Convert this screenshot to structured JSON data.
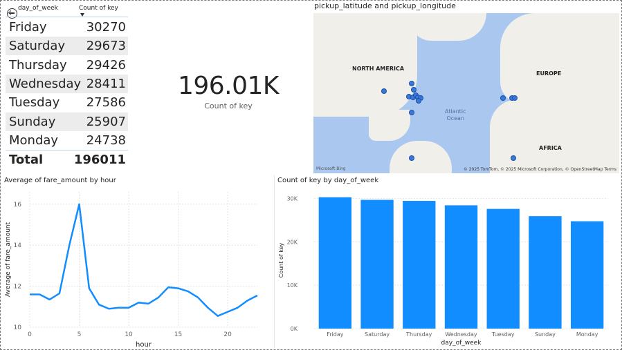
{
  "table": {
    "col1_header": "day_of_week",
    "col2_header": "Count of key",
    "rows": [
      {
        "day": "Friday",
        "count": "30270"
      },
      {
        "day": "Saturday",
        "count": "29673"
      },
      {
        "day": "Thursday",
        "count": "29426"
      },
      {
        "day": "Wednesday",
        "count": "28411"
      },
      {
        "day": "Tuesday",
        "count": "27586"
      },
      {
        "day": "Sunday",
        "count": "25907"
      },
      {
        "day": "Monday",
        "count": "24738"
      }
    ],
    "total_label": "Total",
    "total_value": "196011"
  },
  "card": {
    "value": "196.01K",
    "label": "Count of key"
  },
  "map": {
    "title": "pickup_latitude and pickup_longitude",
    "labels": {
      "north_america": "NORTH AMERICA",
      "europe": "EUROPE",
      "africa": "AFRICA",
      "ocean_line1": "Atlantic",
      "ocean_line2": "Ocean"
    },
    "attribution": "© 2025 TomTom, © 2025 Microsoft Corporation, © OpenStreetMap  Terms",
    "provider": "Microsoft Bing",
    "pin_color": "#3a78d8"
  },
  "chart_data": [
    {
      "type": "line",
      "title": "Average of fare_amount by hour",
      "xlabel": "hour",
      "ylabel": "Average of fare_amount",
      "x": [
        0,
        1,
        2,
        3,
        4,
        5,
        6,
        7,
        8,
        9,
        10,
        11,
        12,
        13,
        14,
        15,
        16,
        17,
        18,
        19,
        20,
        21,
        22,
        23
      ],
      "values": [
        11.6,
        11.6,
        11.35,
        11.65,
        14.0,
        16.0,
        11.9,
        11.1,
        10.9,
        10.95,
        10.95,
        11.2,
        11.15,
        11.45,
        11.95,
        11.9,
        11.75,
        11.45,
        10.95,
        10.55,
        10.75,
        10.95,
        11.3,
        11.55
      ],
      "xlim": [
        0,
        23
      ],
      "ylim": [
        10,
        16.6
      ],
      "xticks": [
        0,
        5,
        10,
        15,
        20
      ],
      "yticks": [
        10,
        12,
        14,
        16
      ],
      "color": "#118dff",
      "grid": true
    },
    {
      "type": "bar",
      "title": "Count of key by day_of_week",
      "xlabel": "day_of_week",
      "ylabel": "Count of key",
      "categories": [
        "Friday",
        "Saturday",
        "Thursday",
        "Wednesday",
        "Tuesday",
        "Sunday",
        "Monday"
      ],
      "values": [
        30270,
        29673,
        29426,
        28411,
        27586,
        25907,
        24738
      ],
      "ylim": [
        0,
        31500
      ],
      "yticks": [
        0,
        10000,
        20000,
        30000
      ],
      "ytick_labels": [
        "0K",
        "10K",
        "20K",
        "30K"
      ],
      "color": "#118dff",
      "grid": true
    }
  ]
}
